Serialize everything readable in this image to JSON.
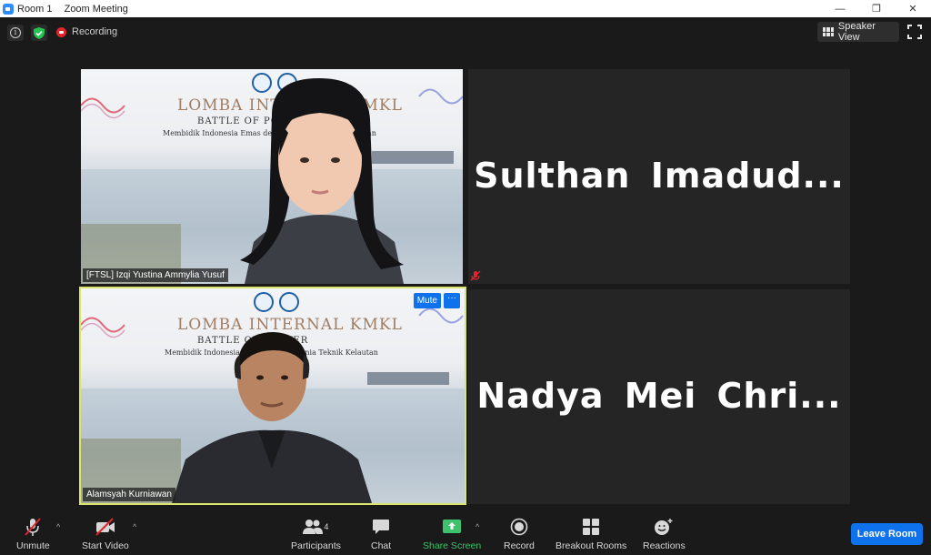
{
  "window": {
    "room": "Room 1",
    "app_title": "Zoom Meeting",
    "minimize": "—",
    "restore": "❐",
    "close": "✕"
  },
  "topbar": {
    "recording_label": "Recording",
    "view_label": "Speaker View"
  },
  "tiles": [
    {
      "participant": "[FTSL] Izqi Yustina Ammylia Yusuf",
      "banner_title": "LOMBA INTERNAL KMKL",
      "banner_line2": "BATTLE OF POSTER",
      "banner_line3": "Membidik Indonesia Emas dengan Dunia Teknik Kelautan"
    },
    {
      "participant": "Sulthan Imadud...",
      "muted": true
    },
    {
      "participant": "Alamsyah Kurniawan",
      "banner_title": "LOMBA INTERNAL KMKL",
      "banner_line2": "BATTLE OF POSTER",
      "banner_line3": "Membidik Indonesia Emas dengan Dunia Teknik Kelautan",
      "mute_label": "Mute",
      "more_label": "···",
      "active_speaker": true
    },
    {
      "participant": "Nadya Mei Chri..."
    }
  ],
  "toolbar": {
    "unmute": "Unmute",
    "start_video": "Start Video",
    "participants": "Participants",
    "participants_count": "4",
    "chat": "Chat",
    "share_screen": "Share Screen",
    "record": "Record",
    "breakout_rooms": "Breakout Rooms",
    "reactions": "Reactions",
    "leave": "Leave Room",
    "caret": "^"
  },
  "colors": {
    "background": "#1a1a1a",
    "accent_blue": "#0e72ed",
    "share_green": "#3ec26d",
    "active_speaker_border": "#d9e66b",
    "muted_red": "#e0262c"
  }
}
